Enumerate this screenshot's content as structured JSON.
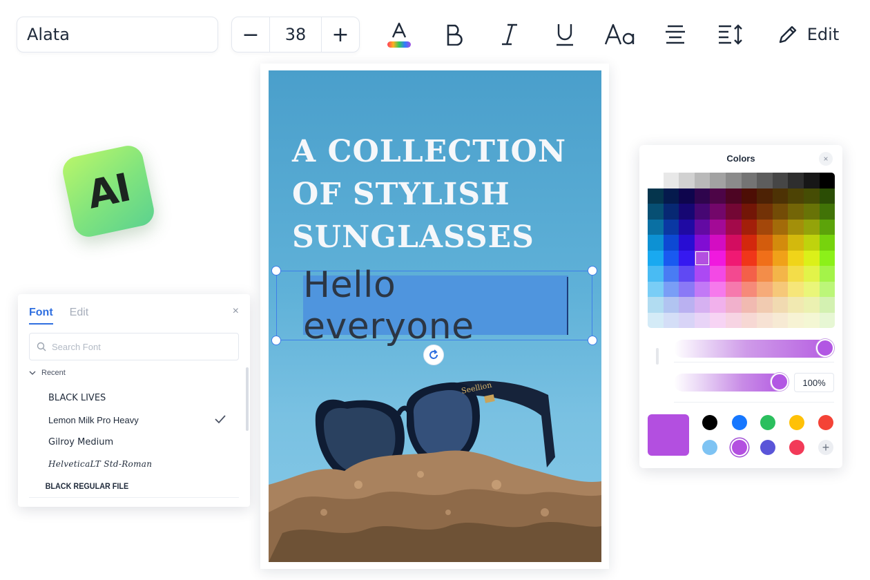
{
  "toolbar": {
    "font_name": "Alata",
    "font_size": "38",
    "decrease_label": "−",
    "increase_label": "+",
    "bold_label": "B",
    "case_label": "Aa",
    "edit_label": "Edit"
  },
  "poster": {
    "headline_lines": [
      "A COLLECTION",
      "OF STYLISH",
      "SUNGLASSES"
    ],
    "selected_text": "Hello everyone",
    "sunglasses_brand": "Seellion"
  },
  "ai_badge": {
    "label": "AI"
  },
  "font_panel": {
    "tabs": [
      {
        "label": "Font",
        "active": true
      },
      {
        "label": "Edit",
        "active": false
      }
    ],
    "close_label": "×",
    "search_placeholder": "Search Font",
    "group_label": "Recent",
    "fonts": [
      {
        "label": "BLACK LIVES",
        "selected": false
      },
      {
        "label": "Lemon Milk Pro Heavy",
        "selected": true
      },
      {
        "label": "Gilroy Medium",
        "selected": false
      },
      {
        "label": "HelveticaLT Std-Roman",
        "selected": false
      },
      {
        "label": "BLACK REGULAR FILE",
        "selected": false
      }
    ]
  },
  "colors_panel": {
    "title": "Colors",
    "close_label": "×",
    "selected_color": "#b34fe0",
    "hue_position": 1.0,
    "opacity_position": 1.0,
    "opacity_value": "100%",
    "preset_colors": [
      {
        "name": "black",
        "hex": "#000000"
      },
      {
        "name": "blue",
        "hex": "#1677ff"
      },
      {
        "name": "green",
        "hex": "#2bbf5e"
      },
      {
        "name": "yellow",
        "hex": "#ffc107"
      },
      {
        "name": "red",
        "hex": "#f44336"
      },
      {
        "name": "light-blue",
        "hex": "#7ec3f3"
      },
      {
        "name": "purple",
        "hex": "#b34fe0"
      },
      {
        "name": "indigo",
        "hex": "#5a55d8"
      },
      {
        "name": "crimson",
        "hex": "#f23a58"
      }
    ],
    "add_label": "+"
  },
  "colors": {
    "accent": "#2f6fe0",
    "selection": "#3f7ee8"
  }
}
